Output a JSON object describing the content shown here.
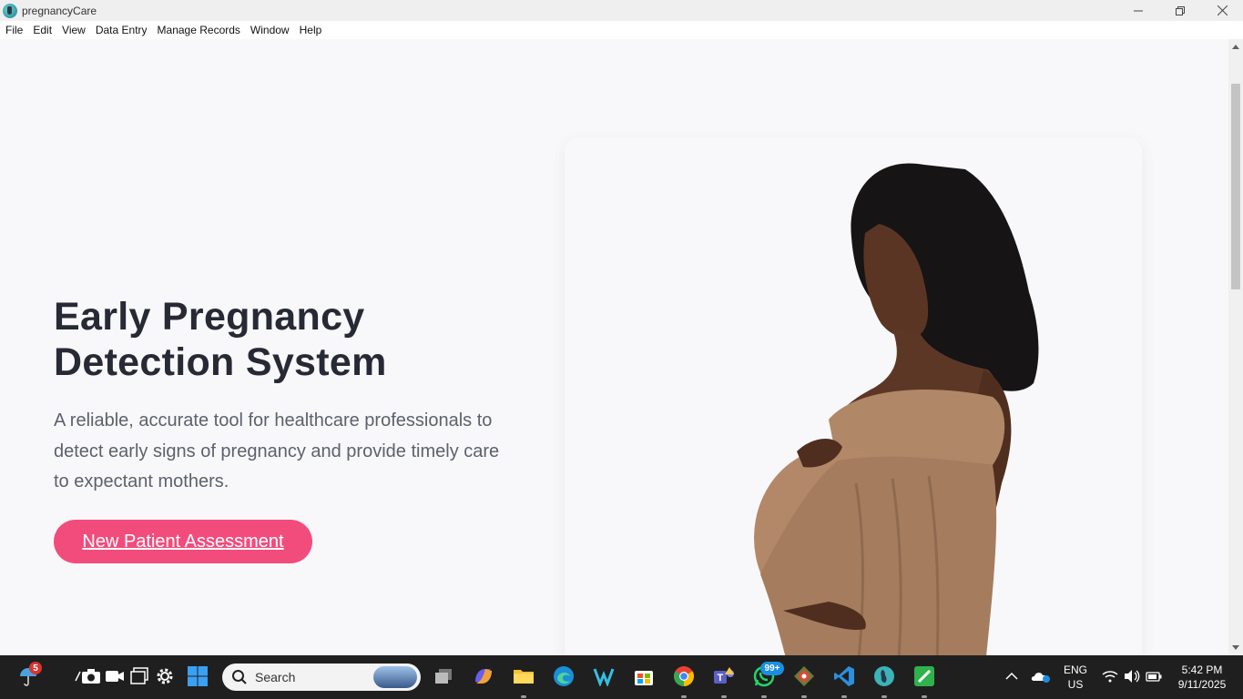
{
  "window": {
    "title": "pregnancyCare",
    "icon": "pregnancy-care-app-icon"
  },
  "menu": [
    "File",
    "Edit",
    "View",
    "Data Entry",
    "Manage Records",
    "Window",
    "Help"
  ],
  "hero": {
    "title_line1": "Early Pregnancy",
    "title_line2": "Detection System",
    "subtitle": "A reliable, accurate tool for healthcare professionals to detect early signs of pregnancy and provide timely care to expectant mothers.",
    "cta_label": "New Patient Assessment",
    "image": "pregnant-woman-photo"
  },
  "colors": {
    "accent": "#f24c7c",
    "title": "#272a35",
    "subtitle": "#5d616c",
    "background": "#f8f8fa"
  },
  "taskbar": {
    "weather_badge": "5",
    "search_placeholder": "Search",
    "whatsapp_badge": "99+",
    "language": "ENG",
    "region": "US",
    "time": "5:42 PM",
    "date": "9/11/2025"
  }
}
